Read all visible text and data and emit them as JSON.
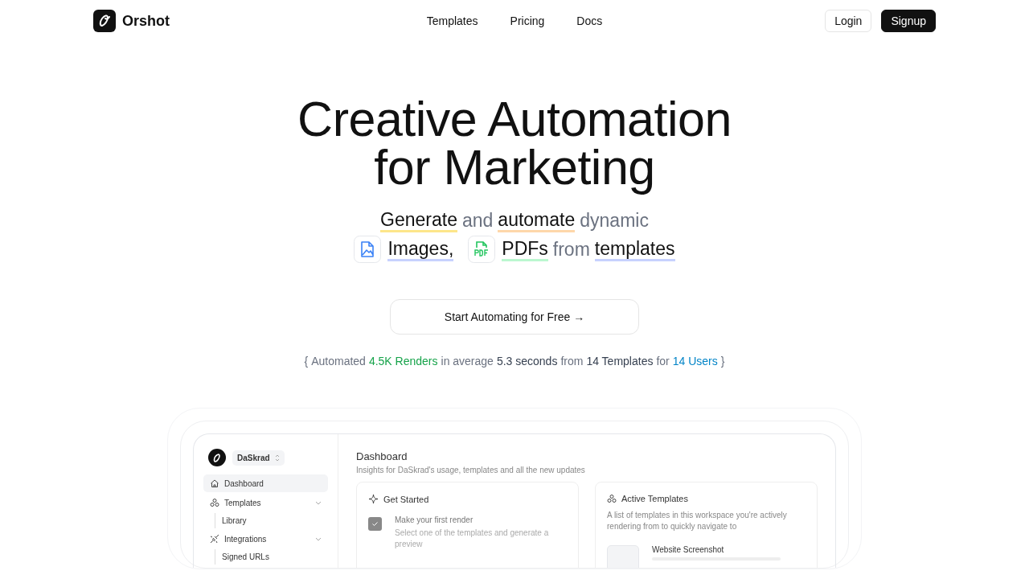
{
  "brand": {
    "name": "Orshot"
  },
  "nav": [
    {
      "label": "Templates"
    },
    {
      "label": "Pricing"
    },
    {
      "label": "Docs"
    }
  ],
  "auth": [
    {
      "label": "Login",
      "kind": "outline"
    },
    {
      "label": "Signup",
      "kind": "solid"
    }
  ],
  "hero": {
    "title_lines": [
      "Creative Automation",
      "for Marketing"
    ],
    "subtitle_lines": [
      [
        {
          "text": "Generate",
          "kind": "word",
          "emphasis": true,
          "color": "#fde68a"
        },
        {
          "text": "and",
          "kind": "word",
          "emphasis": false
        },
        {
          "text": "automate",
          "kind": "word",
          "emphasis": true,
          "color": "#fed7aa"
        },
        {
          "text": "dynamic",
          "kind": "word",
          "emphasis": false
        }
      ],
      [
        {
          "text": "Images,",
          "kind": "image",
          "emphasis": true,
          "color": "#c7d2fe"
        },
        {
          "text": "PDFs",
          "kind": "pdf",
          "emphasis": true,
          "color": "#bbf7d0"
        },
        {
          "text": "from",
          "kind": "word",
          "emphasis": false
        },
        {
          "text": "templates",
          "kind": "word",
          "emphasis": true,
          "color": "#c7d2fe"
        }
      ]
    ]
  },
  "cta": {
    "label": "Start Automating for Free →"
  },
  "stats": [
    {
      "text": "{",
      "color": "#6b7280"
    },
    {
      "text": "Automated",
      "color": "#6b7280"
    },
    {
      "text": "4.5K Renders",
      "color": "#16a34a"
    },
    {
      "text": "in average",
      "color": "#6b7280"
    },
    {
      "text": "5.3 seconds",
      "color": "#374151"
    },
    {
      "text": "from",
      "color": "#6b7280"
    },
    {
      "text": "14 Templates",
      "color": "#374151"
    },
    {
      "text": "for",
      "color": "#6b7280"
    },
    {
      "text": "14 Users",
      "color": "#0284c7"
    },
    {
      "text": "}",
      "color": "#6b7280"
    }
  ],
  "app": {
    "workspace": "DaSkrad",
    "sidebar": [
      {
        "label": "Dashboard",
        "selected": true
      },
      {
        "label": "Templates",
        "selected": false,
        "expanded": true,
        "children": [
          {
            "label": "Library",
            "selected": false
          }
        ]
      },
      {
        "label": "Integrations",
        "selected": false,
        "expanded": true,
        "children": [
          {
            "label": "Signed URLs",
            "selected": false
          }
        ]
      }
    ],
    "title": "Dashboard",
    "subtitle": "Insights for DaSkrad's usage, templates and all the new updates",
    "get_started": {
      "title": "Get Started",
      "tasks": [
        {
          "title": "Make your first render",
          "description": "Select one of the templates and generate a preview",
          "checked": true
        }
      ]
    },
    "active_templates": {
      "title": "Active Templates",
      "description": "A list of templates in this workspace you're actively rendering from to quickly navigate to",
      "templates": [
        {
          "name": "Website Screenshot"
        }
      ]
    }
  }
}
